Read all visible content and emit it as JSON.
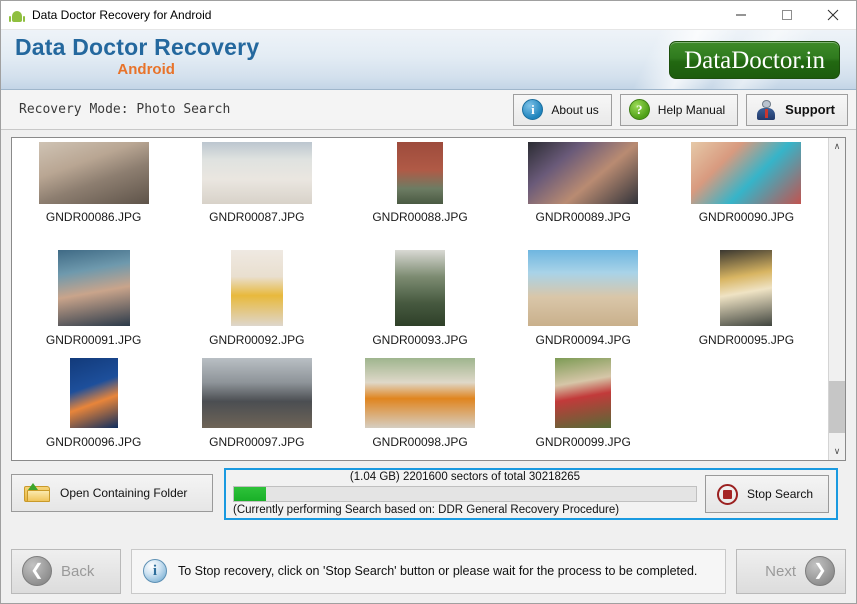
{
  "titlebar": {
    "app_icon": "android-robot-icon",
    "title": "Data Doctor Recovery for Android",
    "minimize": "—",
    "maximize": "□",
    "close": "✕"
  },
  "brand": {
    "title": "Data Doctor Recovery",
    "subtitle": "Android",
    "logo": "DataDoctor.in",
    "logo_bg": "#2b7418",
    "title_color": "#24689e",
    "subtitle_color": "#e8732a"
  },
  "modebar": {
    "mode_label": "Recovery Mode: Photo Search",
    "buttons": [
      {
        "label": "About us",
        "icon": "info-icon"
      },
      {
        "label": "Help Manual",
        "icon": "question-icon"
      },
      {
        "label": "Support",
        "icon": "support-person-icon"
      }
    ]
  },
  "thumbnails": {
    "rows": [
      [
        {
          "name": "GNDR00086.JPG",
          "shape": "wide"
        },
        {
          "name": "GNDR00087.JPG",
          "shape": "wide"
        },
        {
          "name": "GNDR00088.JPG",
          "shape": "tall"
        },
        {
          "name": "GNDR00089.JPG",
          "shape": "wide"
        },
        {
          "name": "GNDR00090.JPG",
          "shape": "wide"
        }
      ],
      [
        {
          "name": "GNDR00091.JPG",
          "shape": "sq"
        },
        {
          "name": "GNDR00092.JPG",
          "shape": "tall"
        },
        {
          "name": "GNDR00093.JPG",
          "shape": "tall"
        },
        {
          "name": "GNDR00094.JPG",
          "shape": "wide"
        },
        {
          "name": "GNDR00095.JPG",
          "shape": "tall"
        }
      ],
      [
        {
          "name": "GNDR00096.JPG",
          "shape": "tall"
        },
        {
          "name": "GNDR00097.JPG",
          "shape": "wide"
        },
        {
          "name": "GNDR00098.JPG",
          "shape": "wide"
        },
        {
          "name": "GNDR00099.JPG",
          "shape": "tall"
        },
        {
          "name": "",
          "shape": "none"
        }
      ]
    ],
    "scroll_up": "∧",
    "scroll_down": "∨"
  },
  "actions": {
    "open_folder_label": "Open Containing Folder",
    "open_folder_icon": "folder-up-icon",
    "stop_label": "Stop Search",
    "stop_icon": "stop-record-icon"
  },
  "progress": {
    "caption": "(1.04 GB) 2201600  sectors  of  total 30218265",
    "sub_caption": "(Currently performing Search based on:  DDR General Recovery Procedure)",
    "percent": 7,
    "fill_color": "#19b028",
    "border_color": "#1a9ae0"
  },
  "footer": {
    "back_label": "Back",
    "back_icon": "chevron-left-icon",
    "next_label": "Next",
    "next_icon": "chevron-right-icon",
    "info_icon": "info-icon",
    "info_text": "To Stop recovery, click on 'Stop Search' button or please wait for the process to be completed."
  }
}
